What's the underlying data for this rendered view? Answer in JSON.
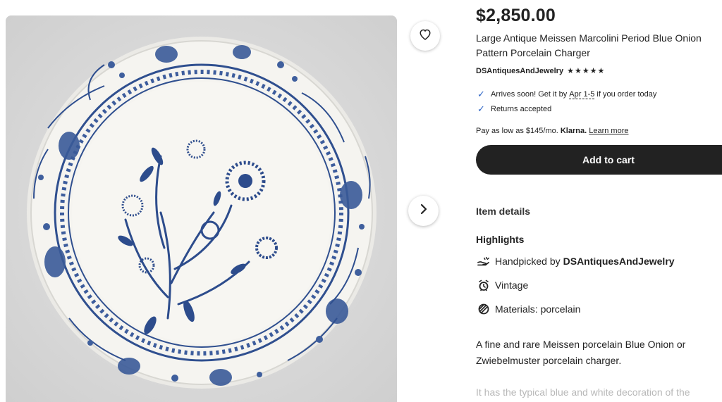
{
  "listing": {
    "price": "$2,850.00",
    "title": "Large Antique Meissen Marcolini Period Blue Onion Pattern Porcelain Charger",
    "shop_name": "DSAntiquesAndJewelry",
    "rating_stars": "★★★★★",
    "rating_value": 5
  },
  "shipping": {
    "arrives_prefix": "Arrives soon! Get it by",
    "arrives_date": "Apr 1-5",
    "arrives_suffix": "if you order today",
    "returns": "Returns accepted"
  },
  "klarna": {
    "prefix": "Pay as low as $145/mo.",
    "brand": "Klarna.",
    "link": "Learn more"
  },
  "buttons": {
    "add_to_cart": "Add to cart"
  },
  "item_details": {
    "heading": "Item details",
    "highlights_heading": "Highlights",
    "handpicked_prefix": "Handpicked by",
    "handpicked_shop": "DSAntiquesAndJewelry",
    "vintage": "Vintage",
    "materials": "Materials: porcelain"
  },
  "description": {
    "text": "A fine and rare Meissen porcelain Blue Onion or Zwiebelmuster porcelain charger.",
    "faded": "It has the typical blue and white decoration of the"
  },
  "icons": {
    "favorite": "heart-icon",
    "next": "chevron-right-icon",
    "check": "check-icon",
    "handpicked": "hand-icon",
    "vintage": "alarm-clock-icon",
    "materials": "materials-icon"
  },
  "colors": {
    "button": "#222222",
    "check": "#2f66c6",
    "plate_blue": "#2f4f8f",
    "plate_bg": "#f4f3ef"
  }
}
